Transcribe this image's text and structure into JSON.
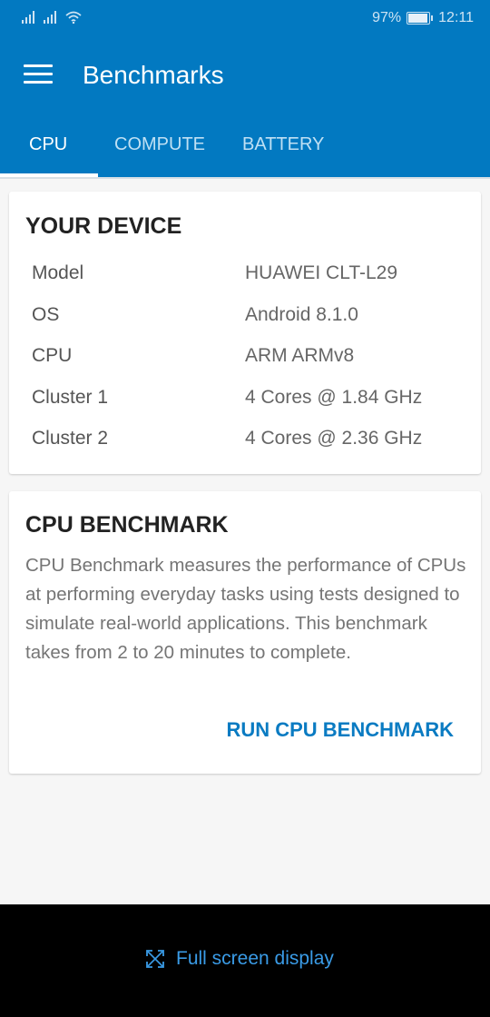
{
  "status_bar": {
    "battery": "97%",
    "time": "12:11"
  },
  "app_bar": {
    "title": "Benchmarks"
  },
  "tabs": [
    {
      "label": "CPU",
      "active": true
    },
    {
      "label": "COMPUTE",
      "active": false
    },
    {
      "label": "BATTERY",
      "active": false
    }
  ],
  "device_card": {
    "heading": "YOUR DEVICE",
    "specs": [
      {
        "label": "Model",
        "value": "HUAWEI CLT-L29"
      },
      {
        "label": "OS",
        "value": "Android 8.1.0"
      },
      {
        "label": "CPU",
        "value": "ARM ARMv8"
      },
      {
        "label": "Cluster 1",
        "value": "4 Cores @ 1.84 GHz"
      },
      {
        "label": "Cluster 2",
        "value": "4 Cores @ 2.36 GHz"
      }
    ]
  },
  "benchmark_card": {
    "heading": "CPU BENCHMARK",
    "description": "CPU Benchmark measures the performance of CPUs at performing everyday tasks using tests designed to simulate real-world applications. This benchmark takes from 2 to 20 minutes to complete.",
    "run_label": "RUN CPU BENCHMARK"
  },
  "bottom_bar": {
    "fullscreen_label": "Full screen display"
  },
  "colors": {
    "primary": "#0279c1",
    "accent": "#0a7bc2",
    "fullscreen_text": "#3a9be6"
  }
}
